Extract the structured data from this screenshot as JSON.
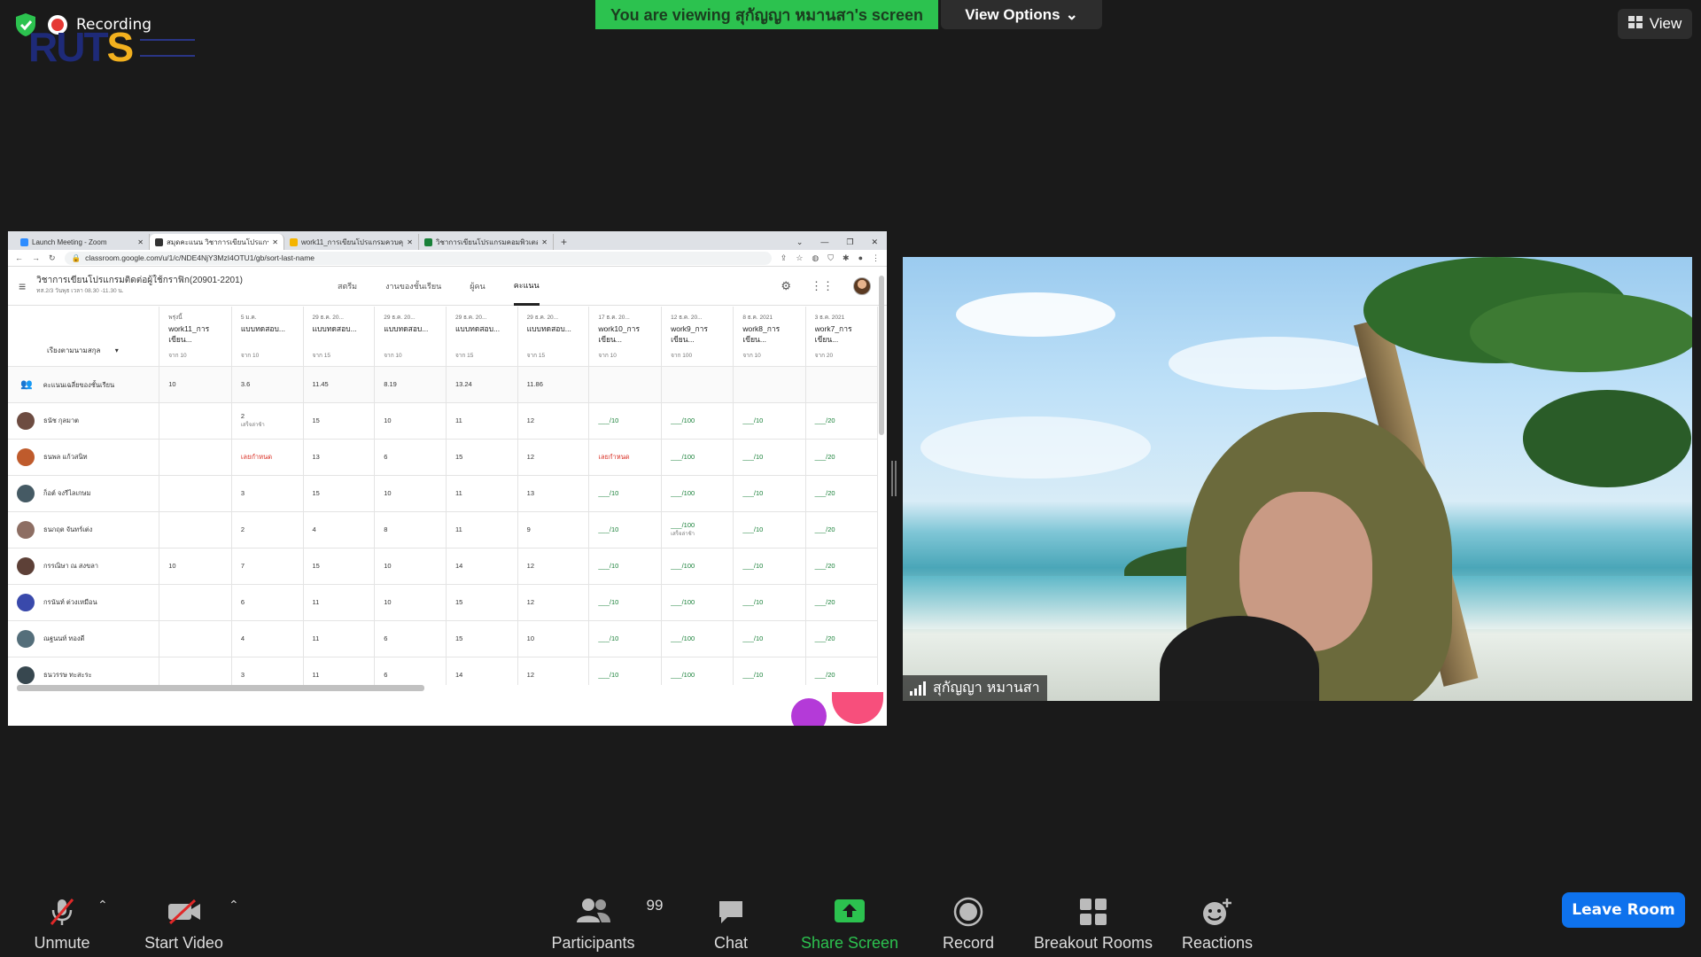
{
  "top": {
    "recording_label": "Recording",
    "logo_main": "RUT",
    "logo_accent": "S",
    "viewing_banner": "You are viewing สุกัญญา หมานสา's screen",
    "view_options_label": "View Options",
    "view_button_label": "View"
  },
  "browser": {
    "tabs": [
      {
        "label": "Launch Meeting - Zoom",
        "color": "#2d8cff"
      },
      {
        "label": "สมุดคะแนน วิชาการเขียนโปรแกรมเชิง",
        "color": "#333333"
      },
      {
        "label": "work11_การเขียนโปรแกรมควบคุมเงื่อนไข",
        "color": "#f4b400"
      },
      {
        "label": "วิชาการเขียนโปรแกรมคอมพิวเตอร์เบื้",
        "color": "#188038"
      }
    ],
    "new_tab": "+",
    "url": "classroom.google.com/u/1/c/NDE4NjY3MzI4OTU1/gb/sort-last-name"
  },
  "classroom": {
    "title": "วิชาการเขียนโปรแกรมติดต่อผู้ใช้กราฟิก(20901-2201)",
    "subtitle": "ทส.2/3 วันพุธ เวลา 08.30 -11.30 น.",
    "nav": [
      "สตรีม",
      "งานของชั้นเรียน",
      "ผู้คน",
      "คะแนน"
    ],
    "active_nav": "คะแนน",
    "sort_label": "เรียงตามนามสกุล",
    "columns": [
      {
        "date": "พรุ่งนี้",
        "title": "work11_การเขียน...",
        "out_of": "จาก 10"
      },
      {
        "date": "5 ม.ค.",
        "title": "แบบทดสอบ...",
        "out_of": "จาก 10"
      },
      {
        "date": "29 ธ.ค. 20...",
        "title": "แบบทดสอบ...",
        "out_of": "จาก 15"
      },
      {
        "date": "29 ธ.ค. 20...",
        "title": "แบบทดสอบ...",
        "out_of": "จาก 10"
      },
      {
        "date": "29 ธ.ค. 20...",
        "title": "แบบทดสอบ...",
        "out_of": "จาก 15"
      },
      {
        "date": "29 ธ.ค. 20...",
        "title": "แบบทดสอบ...",
        "out_of": "จาก 15"
      },
      {
        "date": "17 ธ.ค. 20...",
        "title": "work10_การเขียน...",
        "out_of": "จาก 10"
      },
      {
        "date": "12 ธ.ค. 20...",
        "title": "work9_การเขียน...",
        "out_of": "จาก 100"
      },
      {
        "date": "8 ธ.ค. 2021",
        "title": "work8_การเขียน...",
        "out_of": "จาก 10"
      },
      {
        "date": "3 ธ.ค. 2021",
        "title": "work7_การเขียน...",
        "out_of": "จาก 20"
      }
    ],
    "average_row": {
      "label": "คะแนนเฉลี่ยของชั้นเรียน",
      "values": [
        "10",
        "3.6",
        "11.45",
        "8.19",
        "13.24",
        "11.86",
        "",
        "",
        "",
        ""
      ]
    },
    "students": [
      {
        "name": "ธนัช กุลมาต",
        "avatar": "#6d4c41",
        "cells": [
          "",
          "2",
          "15",
          "10",
          "11",
          "12",
          "___/10",
          "___/100",
          "___/10",
          "___/20"
        ],
        "notes": [
          "",
          "เสร็จล่าช้า",
          "",
          "",
          "",
          "",
          "",
          "",
          "",
          ""
        ]
      },
      {
        "name": "ธนพล แก้วสนิท",
        "avatar": "#bf5b2c",
        "cells": [
          "",
          "เลยกำหนด",
          "13",
          "6",
          "15",
          "12",
          "เลยกำหนด",
          "___/100",
          "___/10",
          "___/20"
        ],
        "notes": [
          "",
          "",
          "",
          "",
          "",
          "",
          "",
          "",
          "",
          ""
        ]
      },
      {
        "name": "ก็อต์ จงรีไลเกษม",
        "avatar": "#455a64",
        "cells": [
          "",
          "3",
          "15",
          "10",
          "11",
          "13",
          "___/10",
          "___/100",
          "___/10",
          "___/20"
        ],
        "notes": [
          "",
          "",
          "",
          "",
          "",
          "",
          "",
          "",
          "",
          ""
        ]
      },
      {
        "name": "ธนกฤต จันทร์เต่ง",
        "avatar": "#8d6e63",
        "cells": [
          "",
          "2",
          "4",
          "8",
          "11",
          "9",
          "___/10",
          "___/100",
          "___/10",
          "___/20"
        ],
        "notes": [
          "",
          "",
          "",
          "",
          "",
          "",
          "",
          "เสร็จล่าช้า",
          "",
          ""
        ]
      },
      {
        "name": "กรรณิษา ณ สงขลา",
        "avatar": "#5d4037",
        "cells": [
          "10",
          "7",
          "15",
          "10",
          "14",
          "12",
          "___/10",
          "___/100",
          "___/10",
          "___/20"
        ],
        "notes": [
          "",
          "",
          "",
          "",
          "",
          "",
          "",
          "",
          "",
          ""
        ]
      },
      {
        "name": "กรนันท์ ต่วงเหมือน",
        "avatar": "#3949ab",
        "cells": [
          "",
          "6",
          "11",
          "10",
          "15",
          "12",
          "___/10",
          "___/100",
          "___/10",
          "___/20"
        ],
        "notes": [
          "",
          "",
          "",
          "",
          "",
          "",
          "",
          "",
          "",
          ""
        ]
      },
      {
        "name": "ณฐนนท์ ทองดี",
        "avatar": "#546e7a",
        "cells": [
          "",
          "4",
          "11",
          "6",
          "15",
          "10",
          "___/10",
          "___/100",
          "___/10",
          "___/20"
        ],
        "notes": [
          "",
          "",
          "",
          "",
          "",
          "",
          "",
          "",
          "",
          ""
        ]
      },
      {
        "name": "ธนวรรษ ทะสะระ",
        "avatar": "#37474f",
        "cells": [
          "",
          "3",
          "11",
          "6",
          "14",
          "12",
          "___/10",
          "___/100",
          "___/10",
          "___/20"
        ],
        "notes": [
          "",
          "",
          "",
          "",
          "",
          "",
          "",
          "",
          "",
          ""
        ]
      }
    ]
  },
  "video": {
    "participant_name": "สุกัญญา หมานสา"
  },
  "toolbar": {
    "unmute": "Unmute",
    "start_video": "Start Video",
    "participants": "Participants",
    "participants_count": "99",
    "chat": "Chat",
    "share_screen": "Share Screen",
    "record": "Record",
    "breakout_rooms": "Breakout Rooms",
    "reactions": "Reactions",
    "leave_room": "Leave Room",
    "share_color": "#2cc24f",
    "leave_color": "#0e72ed"
  }
}
